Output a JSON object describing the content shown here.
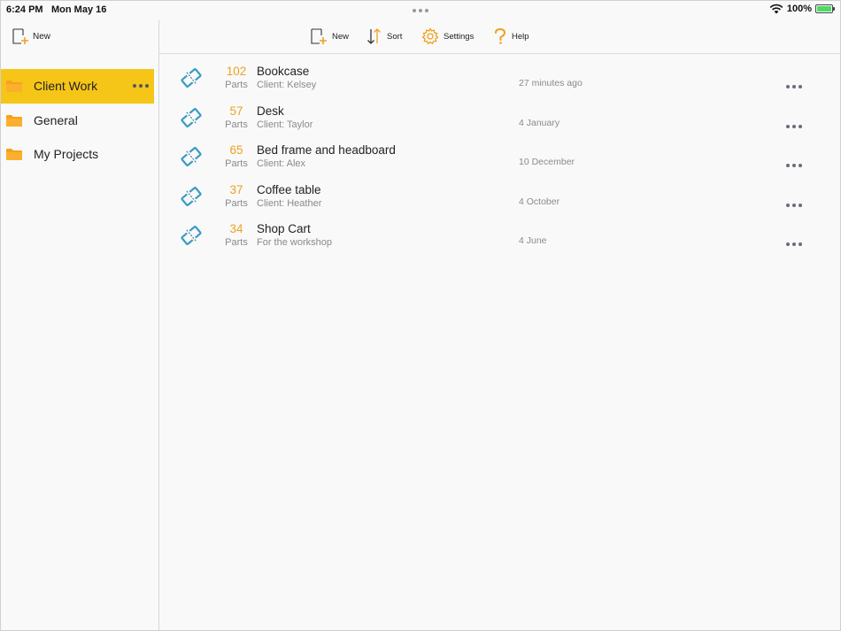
{
  "status_bar": {
    "time": "6:24 PM",
    "date": "Mon May 16",
    "battery": "100%",
    "battery_level": 1.0
  },
  "sidebar": {
    "new_label": "New",
    "folders": [
      {
        "label": "Client Work",
        "selected": true
      },
      {
        "label": "General",
        "selected": false
      },
      {
        "label": "My Projects",
        "selected": false
      }
    ]
  },
  "toolbar": {
    "new_label": "New",
    "sort_label": "Sort",
    "settings_label": "Settings",
    "help_label": "Help"
  },
  "projects": [
    {
      "count": "102",
      "unit": "Parts",
      "name": "Bookcase",
      "subtitle": "Client: Kelsey",
      "date": "27 minutes ago"
    },
    {
      "count": "57",
      "unit": "Parts",
      "name": "Desk",
      "subtitle": "Client: Taylor",
      "date": "4 January"
    },
    {
      "count": "65",
      "unit": "Parts",
      "name": "Bed frame and headboard",
      "subtitle": "Client: Alex",
      "date": "10 December"
    },
    {
      "count": "37",
      "unit": "Parts",
      "name": "Coffee table",
      "subtitle": "Client: Heather",
      "date": "4 October"
    },
    {
      "count": "34",
      "unit": "Parts",
      "name": "Shop Cart",
      "subtitle": "For the workshop",
      "date": "4 June"
    }
  ],
  "colors": {
    "accent_yellow": "#f5c518",
    "folder_orange": "#f7a21b",
    "count_orange": "#f0a020",
    "project_icon_blue": "#3a9cc4",
    "battery_green": "#4cd964"
  },
  "icons": {
    "new": "new-document-icon",
    "sort": "sort-arrows-icon",
    "settings": "gear-icon",
    "help": "question-mark-icon",
    "folder": "folder-icon",
    "project": "cut-sheet-icon"
  }
}
